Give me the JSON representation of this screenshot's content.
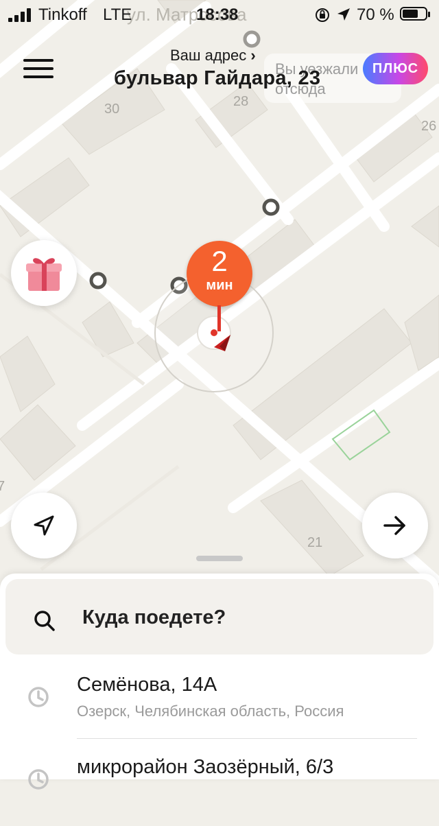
{
  "status_bar": {
    "carrier": "Tinkoff",
    "network": "LTE",
    "time": "18:38",
    "battery_text": "70 %",
    "battery_level": 0.7,
    "signal_bars": 4
  },
  "header": {
    "menu_icon": "hamburger-icon",
    "address_caption": "Ваш адрес",
    "address_caption_chevron": "›",
    "address": "бульвар Гайдара, 23",
    "leave_hint": "Вы уезжали отсюда",
    "plus_label": "ПЛЮС"
  },
  "map": {
    "street_label": "ул. Матросова",
    "house_numbers": [
      "30",
      "28",
      "26",
      "21",
      "7"
    ],
    "eta_value": "2",
    "eta_unit": "мин",
    "colors": {
      "eta": "#f4612e",
      "pin": "#e0352a",
      "background": "#f1efe9",
      "block": "#e7e4dd",
      "road": "#ffffff"
    }
  },
  "controls": {
    "gift_icon": "gift-icon",
    "locate_icon": "navigation-arrow-icon",
    "next_icon": "arrow-right-icon"
  },
  "sheet": {
    "search_label": "Куда поедете?",
    "history": [
      {
        "title": "Семёнова, 14А",
        "subtitle": "Озерск, Челябинская область, Россия"
      },
      {
        "title": "микрорайон Заозёрный, 6/3",
        "subtitle": ""
      }
    ]
  }
}
